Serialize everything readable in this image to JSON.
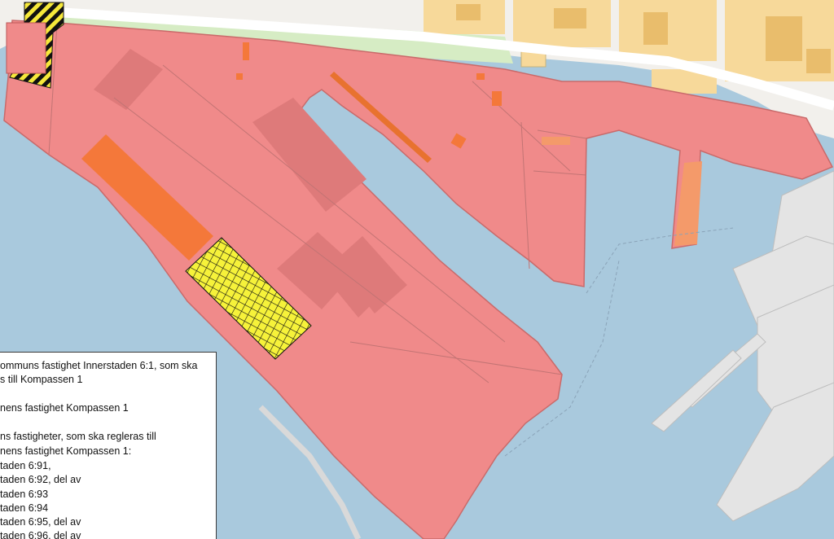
{
  "map": {
    "colors": {
      "water": "#a9c9dd",
      "land": "#f2f0ec",
      "green": "#d6ecc4",
      "road": "#ffffff",
      "buildings": "#f7d99a",
      "buildings_dark": "#e9bd6c",
      "area_fill": "#f08a8a",
      "area_stroke": "#c96a6a",
      "orange_plot": "#f4783a",
      "hatch_yellow": "#f6f23a",
      "hatch_line": "#111111",
      "pier_grey": "#e4e4e4"
    }
  },
  "legend": {
    "lines": [
      "ommuns fastighet Innerstaden 6:1, som ska",
      "s till Kompassen 1",
      "",
      "nens fastighet Kompassen 1",
      "",
      "ns fastigheter, som ska regleras till",
      "nens fastighet Kompassen 1:",
      "taden 6:91,",
      "taden 6:92, del av",
      "taden 6:93",
      "taden 6:94",
      "taden 6:95, del av",
      "taden 6:96, del av"
    ]
  }
}
